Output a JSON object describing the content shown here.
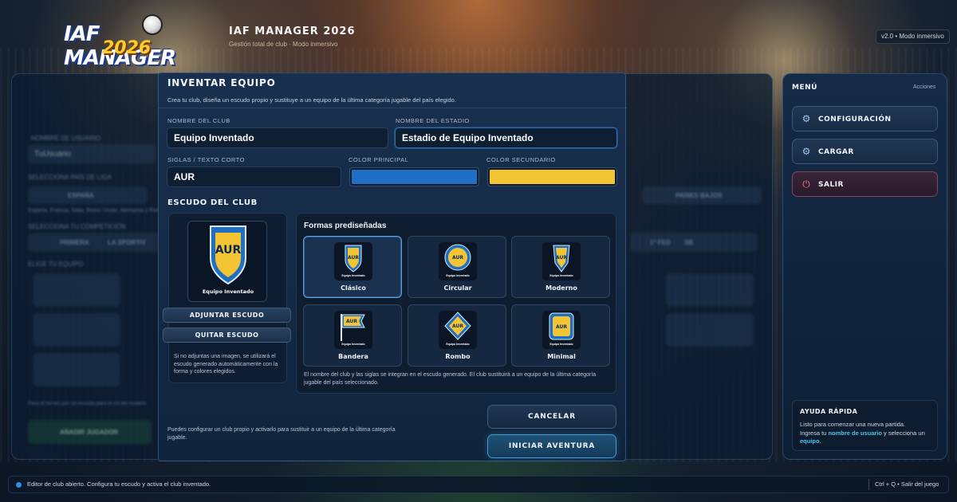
{
  "header": {
    "logo_line1": "IAF MANAGER",
    "logo_line2": "2026",
    "app_title": "IAF MANAGER 2026",
    "app_subtitle": "Gestión total de club · Modo inmersivo",
    "version": "v2.0 • Modo inmersivo"
  },
  "background": {
    "username_label": "NOMBRE DE USUARIO",
    "username_value": "TuUsuario",
    "country_label": "SELECCIONA PAÍS DE LIGA",
    "country_left": "ESPAÑA",
    "country_right": "PAÍSES BAJOS",
    "countries_hint": "España, Francia, Italia, Reino Unido, Alemania y Portugal",
    "competition_label": "SELECCIONA TU COMPETICIÓN",
    "competition_left": "PRIMERA",
    "competition_left2": "LA SPORTIV",
    "competition_right": "1ª FED",
    "competition_right2": "SB",
    "team_label": "ELIGE TU EQUIPO",
    "team_hint": "Para el torneo por un escudo para el rol del modelo",
    "add_player": "AÑADIR JUGADOR"
  },
  "modal": {
    "title": "INVENTAR EQUIPO",
    "description": "Crea tu club, diseña un escudo propio y sustituye a un equipo de la última categoría jugable del país elegido.",
    "club_name_label": "NOMBRE DEL CLUB",
    "club_name_value": "Equipo Inventado",
    "stadium_label": "NOMBRE DEL ESTADIO",
    "stadium_value": "Estadio de Equipo Inventado",
    "short_label": "SIGLAS / TEXTO CORTO",
    "short_value": "AUR",
    "primary_color_label": "COLOR PRINCIPAL",
    "primary_color": "#1f6fc4",
    "secondary_color_label": "COLOR SECUNDARIO",
    "secondary_color": "#f3c434",
    "crest_section_title": "ESCUDO DEL CLUB",
    "crest_preview_abbr": "AUR",
    "crest_preview_name": "Equipo Inventado",
    "attach_button": "ADJUNTAR ESCUDO",
    "remove_button": "QUITAR ESCUDO",
    "crest_note": "Si no adjuntas una imagen, se utilizará el escudo generado automáticamente con la forma y colores elegidos.",
    "shapes_title": "Formas prediseñadas",
    "shapes": [
      {
        "label": "Clásico",
        "icon": "shield-classic-icon",
        "abbr": "AUR",
        "caption": "Equipo Inventado",
        "selected": true
      },
      {
        "label": "Circular",
        "icon": "circle-crest-icon",
        "abbr": "AUR",
        "caption": "Equipo Inventado",
        "selected": false
      },
      {
        "label": "Moderno",
        "icon": "shield-modern-icon",
        "abbr": "AUR",
        "caption": "Equipo Inventado",
        "selected": false
      },
      {
        "label": "Bandera",
        "icon": "flag-crest-icon",
        "abbr": "AUR",
        "caption": "Equipo Inventado",
        "selected": false
      },
      {
        "label": "Rombo",
        "icon": "diamond-crest-icon",
        "abbr": "AUR",
        "caption": "Equipo Inventado",
        "selected": false
      },
      {
        "label": "Minimal",
        "icon": "square-crest-icon",
        "abbr": "AUR",
        "caption": "Equipo Inventado",
        "selected": false
      }
    ],
    "shapes_note": "El nombre del club y las siglas se integran en el escudo generado. El club sustituirá a un equipo de la última categoría jugable del país seleccionado.",
    "footer_note": "Puedes configurar un club propio y activarlo para sustituir a un equipo de la última categoría jugable.",
    "cancel_button": "CANCELAR",
    "start_button": "INICIAR AVENTURA"
  },
  "menu": {
    "title": "MENÚ",
    "actions_label": "Acciones",
    "items": [
      {
        "label": "CONFIGURACIÓN",
        "icon": "gear-icon"
      },
      {
        "label": "CARGAR",
        "icon": "gear-icon"
      },
      {
        "label": "SALIR",
        "icon": "power-icon"
      }
    ],
    "help_title": "AYUDA RÁPIDA",
    "help_line1": "Listo para comenzar una nueva partida.",
    "help_line2_pre": "Ingresa tu ",
    "help_line2_bold": "nombre de usuario",
    "help_line2_post": " y selecciona un ",
    "help_line3_bold": "equipo",
    "help_line3_post": "."
  },
  "status_bar": {
    "message": "Editor de club abierto. Configura tu escudo y activa el club inventado.",
    "shortcut": "Ctrl + Q • Salir del juego"
  }
}
